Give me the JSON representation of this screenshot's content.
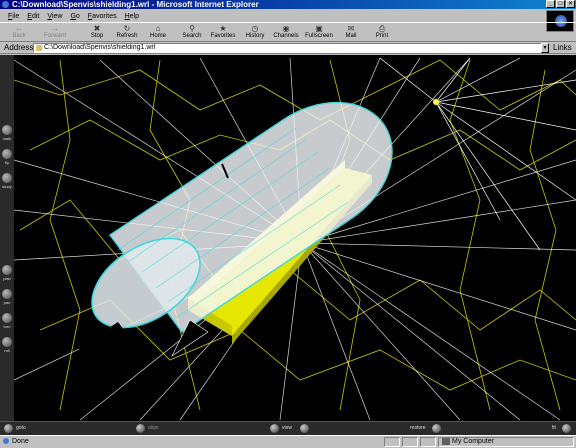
{
  "window": {
    "title": "C:\\Download\\Spenvis\\shielding1.wrl - Microsoft Internet Explorer"
  },
  "menu": [
    "File",
    "Edit",
    "View",
    "Go",
    "Favorites",
    "Help"
  ],
  "toolbar": {
    "back": "Back",
    "forward": "Forward",
    "stop": "Stop",
    "refresh": "Refresh",
    "home": "Home",
    "search": "Search",
    "favorites": "Favorites",
    "history": "History",
    "channels": "Channels",
    "fullscreen": "Fullscreen",
    "mail": "Mail",
    "print": "Print"
  },
  "address": {
    "label": "Address",
    "value": "C:\\Download\\Spenvis\\shielding1.wrl",
    "links": "Links"
  },
  "vrml": {
    "side_labels": {
      "walk": "walk",
      "fly": "fly",
      "study": "study",
      "plan": "plan",
      "pan": "pan",
      "turn": "turn",
      "roll": "roll"
    },
    "bottom_labels": {
      "goto": "goto",
      "align": "align",
      "view": "view",
      "restore": "restore",
      "fit": "fit"
    }
  },
  "status": {
    "text": "Done",
    "zone": "My Computer"
  },
  "colors": {
    "title_start": "#000080",
    "title_end": "#1084d0",
    "cylinder": "#40d8e0",
    "slab": "#ffff00",
    "rays": "#ffffff",
    "wire": "#c8c800"
  }
}
